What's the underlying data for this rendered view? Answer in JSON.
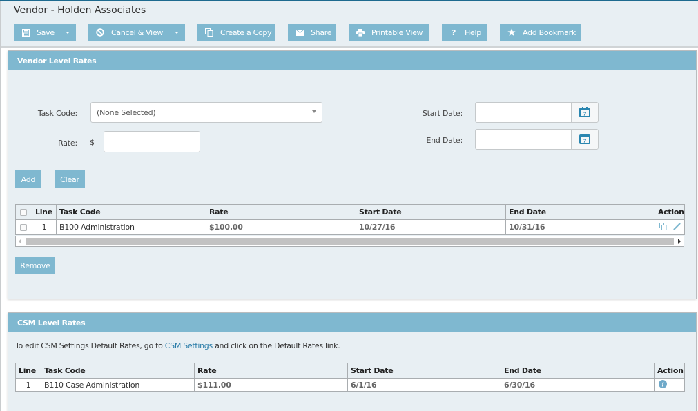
{
  "page": {
    "title": "Vendor - Holden Associates"
  },
  "toolbar": {
    "save": "Save",
    "cancel_view": "Cancel & View",
    "create_copy": "Create a Copy",
    "share": "Share",
    "printable_view": "Printable View",
    "help": "Help",
    "add_bookmark": "Add Bookmark"
  },
  "vendor_rates": {
    "title": "Vendor Level Rates",
    "task_code_label": "Task Code:",
    "task_code_value": "(None Selected)",
    "rate_label": "Rate:",
    "currency_symbol": "$",
    "rate_value": "",
    "start_date_label": "Start Date:",
    "start_date_value": "",
    "end_date_label": "End Date:",
    "end_date_value": "",
    "add_label": "Add",
    "clear_label": "Clear",
    "remove_label": "Remove",
    "columns": [
      "Line",
      "Task Code",
      "Rate",
      "Start Date",
      "End Date",
      "Action"
    ],
    "rows": [
      {
        "line": "1",
        "task_code": "B100 Administration",
        "rate": "$100.00",
        "start_date": "10/27/16",
        "end_date": "10/31/16"
      }
    ]
  },
  "csm_rates": {
    "title": "CSM Level Rates",
    "info_before": "To edit CSM Settings Default Rates, go to ",
    "info_link": "CSM Settings",
    "info_after": " and click on the Default Rates link.",
    "columns": [
      "Line",
      "Task Code",
      "Rate",
      "Start Date",
      "End Date",
      "Action"
    ],
    "rows": [
      {
        "line": "1",
        "task_code": "B110 Case Administration",
        "rate": "$111.00",
        "start_date": "6/1/16",
        "end_date": "6/30/16"
      }
    ]
  },
  "colors": {
    "accent": "#7fb8d0",
    "panel_bg": "#e8eff3",
    "link": "#2a7ca8"
  }
}
